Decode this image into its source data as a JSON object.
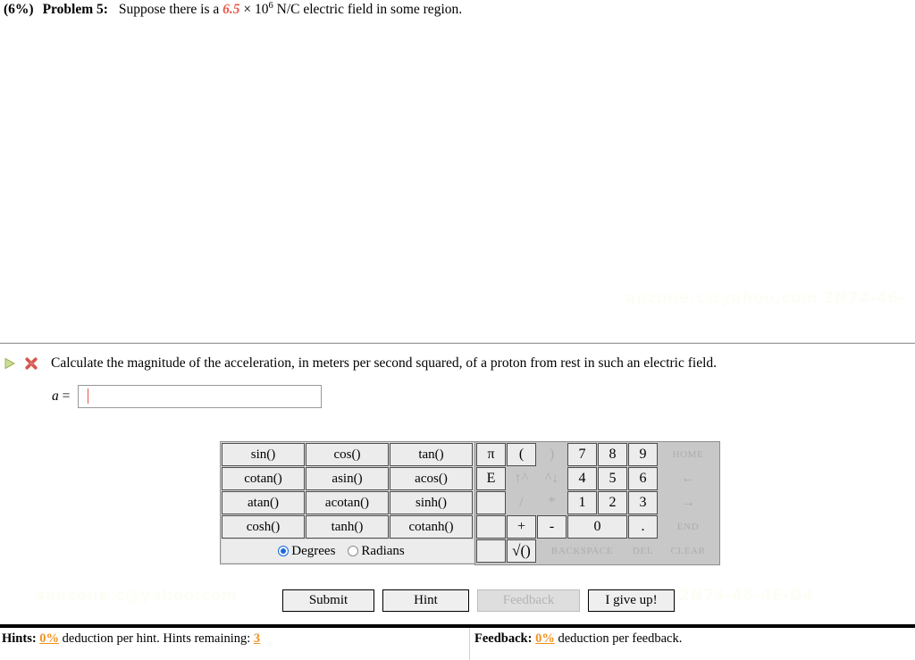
{
  "problem": {
    "percent": "(6%)",
    "number": "Problem 5:",
    "statement_before": "Suppose there is a",
    "statement_value": "6.5",
    "statement_times": "× 10",
    "statement_exponent": "6",
    "statement_after": "N/C electric field in some region."
  },
  "part": {
    "play_icon": "play-triangle-icon",
    "status_icon": "incorrect-x-icon",
    "text": "Calculate the magnitude of the acceleration, in meters per second squared, of a proton from rest in such an electric field.",
    "answer_label": "a",
    "answer_equals": "=",
    "answer_value": "",
    "answer_placeholder": ""
  },
  "watermarks": {
    "top": "anzone.c@yahoo.com 2N74-46-",
    "left": "sanzone.c@yahoo.com",
    "right": "2N74-46-4E-D4"
  },
  "calculator": {
    "function_keys": [
      [
        "sin()",
        "cos()",
        "tan()"
      ],
      [
        "cotan()",
        "asin()",
        "acos()"
      ],
      [
        "atan()",
        "acotan()",
        "sinh()"
      ],
      [
        "cosh()",
        "tanh()",
        "cotanh()"
      ]
    ],
    "angle_mode": {
      "degrees_label": "Degrees",
      "radians_label": "Radians",
      "selected": "Degrees"
    },
    "numeric_rows": [
      [
        {
          "label": "π",
          "kind": "key",
          "width": "w-pi"
        },
        {
          "label": "(",
          "kind": "key",
          "width": "w-std"
        },
        {
          "label": ")",
          "kind": "disabled",
          "width": "w-std"
        },
        {
          "label": "7",
          "kind": "key",
          "width": "w-dig"
        },
        {
          "label": "8",
          "kind": "key",
          "width": "w-dig"
        },
        {
          "label": "9",
          "kind": "key",
          "width": "w-dig"
        },
        {
          "label": "HOME",
          "kind": "disabled-small",
          "width": "w-home"
        }
      ],
      [
        {
          "label": "E",
          "kind": "key",
          "width": "w-pi"
        },
        {
          "label": "↑^",
          "kind": "disabled",
          "width": "w-std"
        },
        {
          "label": "^↓",
          "kind": "disabled",
          "width": "w-std"
        },
        {
          "label": "4",
          "kind": "key",
          "width": "w-dig"
        },
        {
          "label": "5",
          "kind": "key",
          "width": "w-dig"
        },
        {
          "label": "6",
          "kind": "key",
          "width": "w-dig"
        },
        {
          "label": "←",
          "kind": "disabled",
          "width": "w-home"
        }
      ],
      [
        {
          "label": "",
          "kind": "blank",
          "width": "w-pi"
        },
        {
          "label": "/",
          "kind": "disabled",
          "width": "w-std"
        },
        {
          "label": "*",
          "kind": "disabled",
          "width": "w-std"
        },
        {
          "label": "1",
          "kind": "key",
          "width": "w-dig"
        },
        {
          "label": "2",
          "kind": "key",
          "width": "w-dig"
        },
        {
          "label": "3",
          "kind": "key",
          "width": "w-dig"
        },
        {
          "label": "→",
          "kind": "disabled",
          "width": "w-home"
        }
      ],
      [
        {
          "label": "",
          "kind": "blank",
          "width": "w-pi"
        },
        {
          "label": "+",
          "kind": "key",
          "width": "w-std"
        },
        {
          "label": "-",
          "kind": "key",
          "width": "w-std"
        },
        {
          "label": "0",
          "kind": "key",
          "width": "w-zero"
        },
        {
          "label": ".",
          "kind": "key",
          "width": "w-dig"
        },
        {
          "label": "END",
          "kind": "disabled-small",
          "width": "w-home"
        }
      ],
      [
        {
          "label": "",
          "kind": "blank",
          "width": "w-pi"
        },
        {
          "label": "√()",
          "kind": "key",
          "width": "w-std"
        },
        {
          "label": "BACKSPACE",
          "kind": "disabled-small",
          "width": "w-bksp"
        },
        {
          "label": "DEL",
          "kind": "disabled-small",
          "width": "w-del"
        },
        {
          "label": "CLEAR",
          "kind": "disabled-small",
          "width": "w-clr"
        }
      ]
    ]
  },
  "actions": {
    "submit": "Submit",
    "hint": "Hint",
    "feedback": "Feedback",
    "giveup": "I give up!"
  },
  "footer": {
    "hints_key": "Hints:",
    "hints_pct": "0%",
    "hints_mid": "deduction per hint. Hints remaining:",
    "hints_remaining": "3",
    "feedback_key": "Feedback:",
    "feedback_pct": "0%",
    "feedback_mid": "deduction per feedback."
  },
  "colors": {
    "accent_red": "#e8574a",
    "accent_orange": "#f0921e",
    "radio_blue": "#1668dd"
  }
}
